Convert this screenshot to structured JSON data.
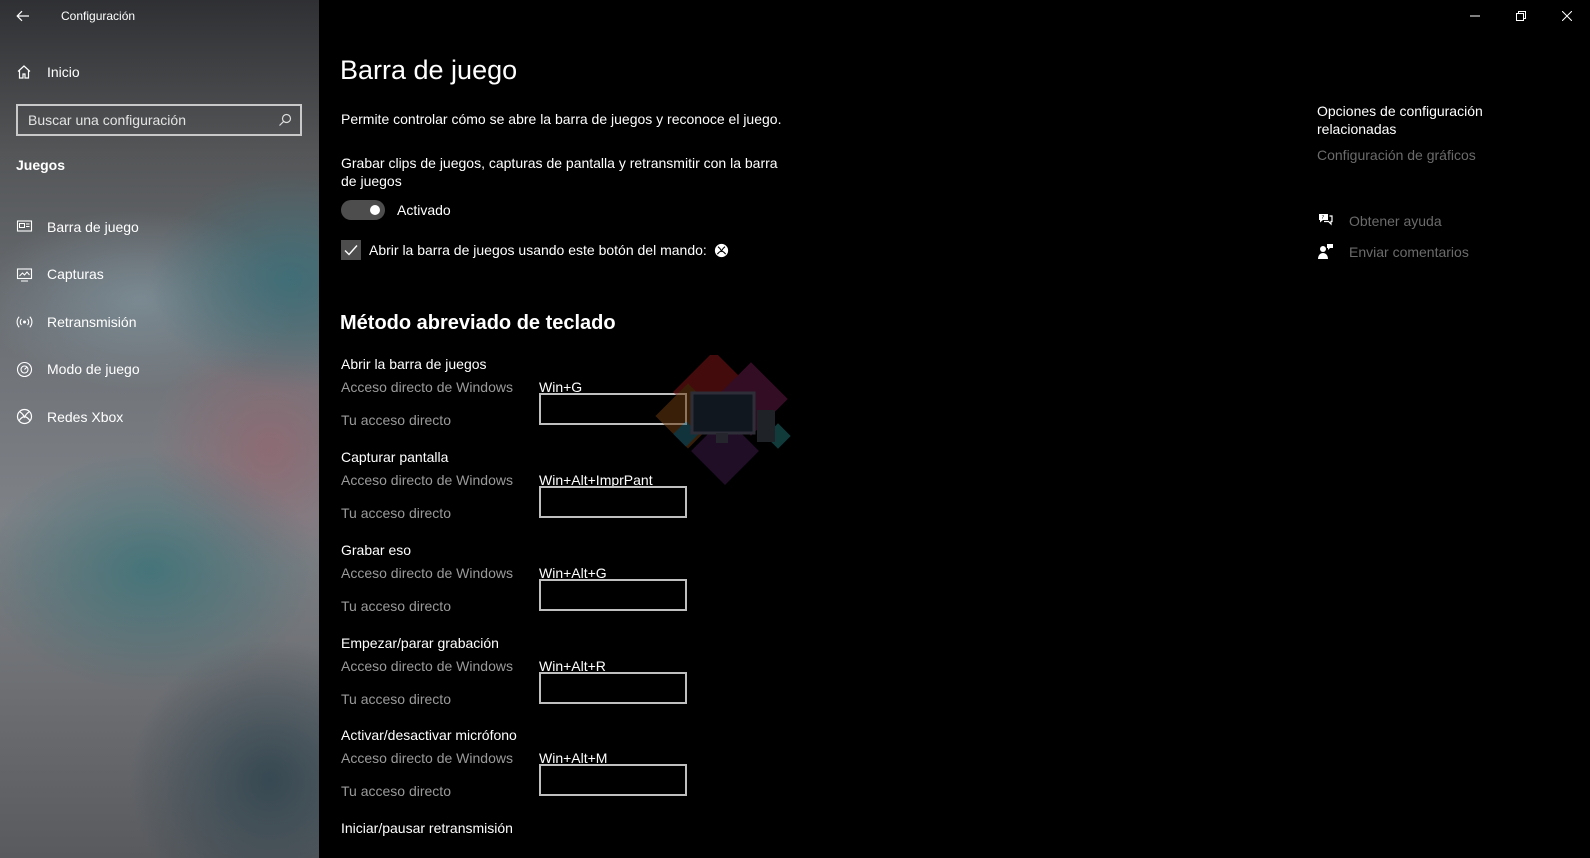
{
  "titlebar": {
    "app_title": "Configuración",
    "icons": [
      "back-arrow-icon",
      "minimize-icon",
      "maximize-icon",
      "close-icon"
    ]
  },
  "sidebar": {
    "home_label": "Inicio",
    "search_placeholder": "Buscar una configuración",
    "section_title": "Juegos",
    "items": [
      {
        "label": "Barra de juego",
        "icon": "game-bar-icon"
      },
      {
        "label": "Capturas",
        "icon": "captures-icon"
      },
      {
        "label": "Retransmisión",
        "icon": "broadcast-icon"
      },
      {
        "label": "Modo de juego",
        "icon": "game-mode-icon"
      },
      {
        "label": "Redes Xbox",
        "icon": "xbox-icon"
      }
    ]
  },
  "main": {
    "title": "Barra de juego",
    "description": "Permite controlar cómo se abre la barra de juegos y reconoce el juego.",
    "record_label": "Grabar clips de juegos, capturas de pantalla y retransmitir con la barra de juegos",
    "toggle_state": "Activado",
    "toggle_on": true,
    "checkbox_label": "Abrir la barra de juegos usando este botón del mando:",
    "checkbox_checked": true,
    "shortcuts_heading": "Método abreviado de teclado",
    "win_shortcut_label": "Acceso directo de Windows",
    "your_shortcut_label": "Tu acceso directo",
    "shortcuts": [
      {
        "title": "Abrir la barra de juegos",
        "windows": "Win+G",
        "custom": ""
      },
      {
        "title": "Capturar pantalla",
        "windows": "Win+Alt+ImprPant",
        "custom": ""
      },
      {
        "title": "Grabar eso",
        "windows": "Win+Alt+G",
        "custom": ""
      },
      {
        "title": "Empezar/parar grabación",
        "windows": "Win+Alt+R",
        "custom": ""
      },
      {
        "title": "Activar/desactivar micrófono",
        "windows": "Win+Alt+M",
        "custom": ""
      }
    ],
    "last_shortcut_title": "Iniciar/pausar retransmisión"
  },
  "related": {
    "title": "Opciones de configuración relacionadas",
    "link": "Configuración de gráficos",
    "help": "Obtener ayuda",
    "feedback": "Enviar comentarios"
  },
  "colors": {
    "background": "#000000",
    "muted_text": "#9a9a9a",
    "link_text": "#6b6b6b",
    "toggle_track": "#4d4d4d"
  }
}
